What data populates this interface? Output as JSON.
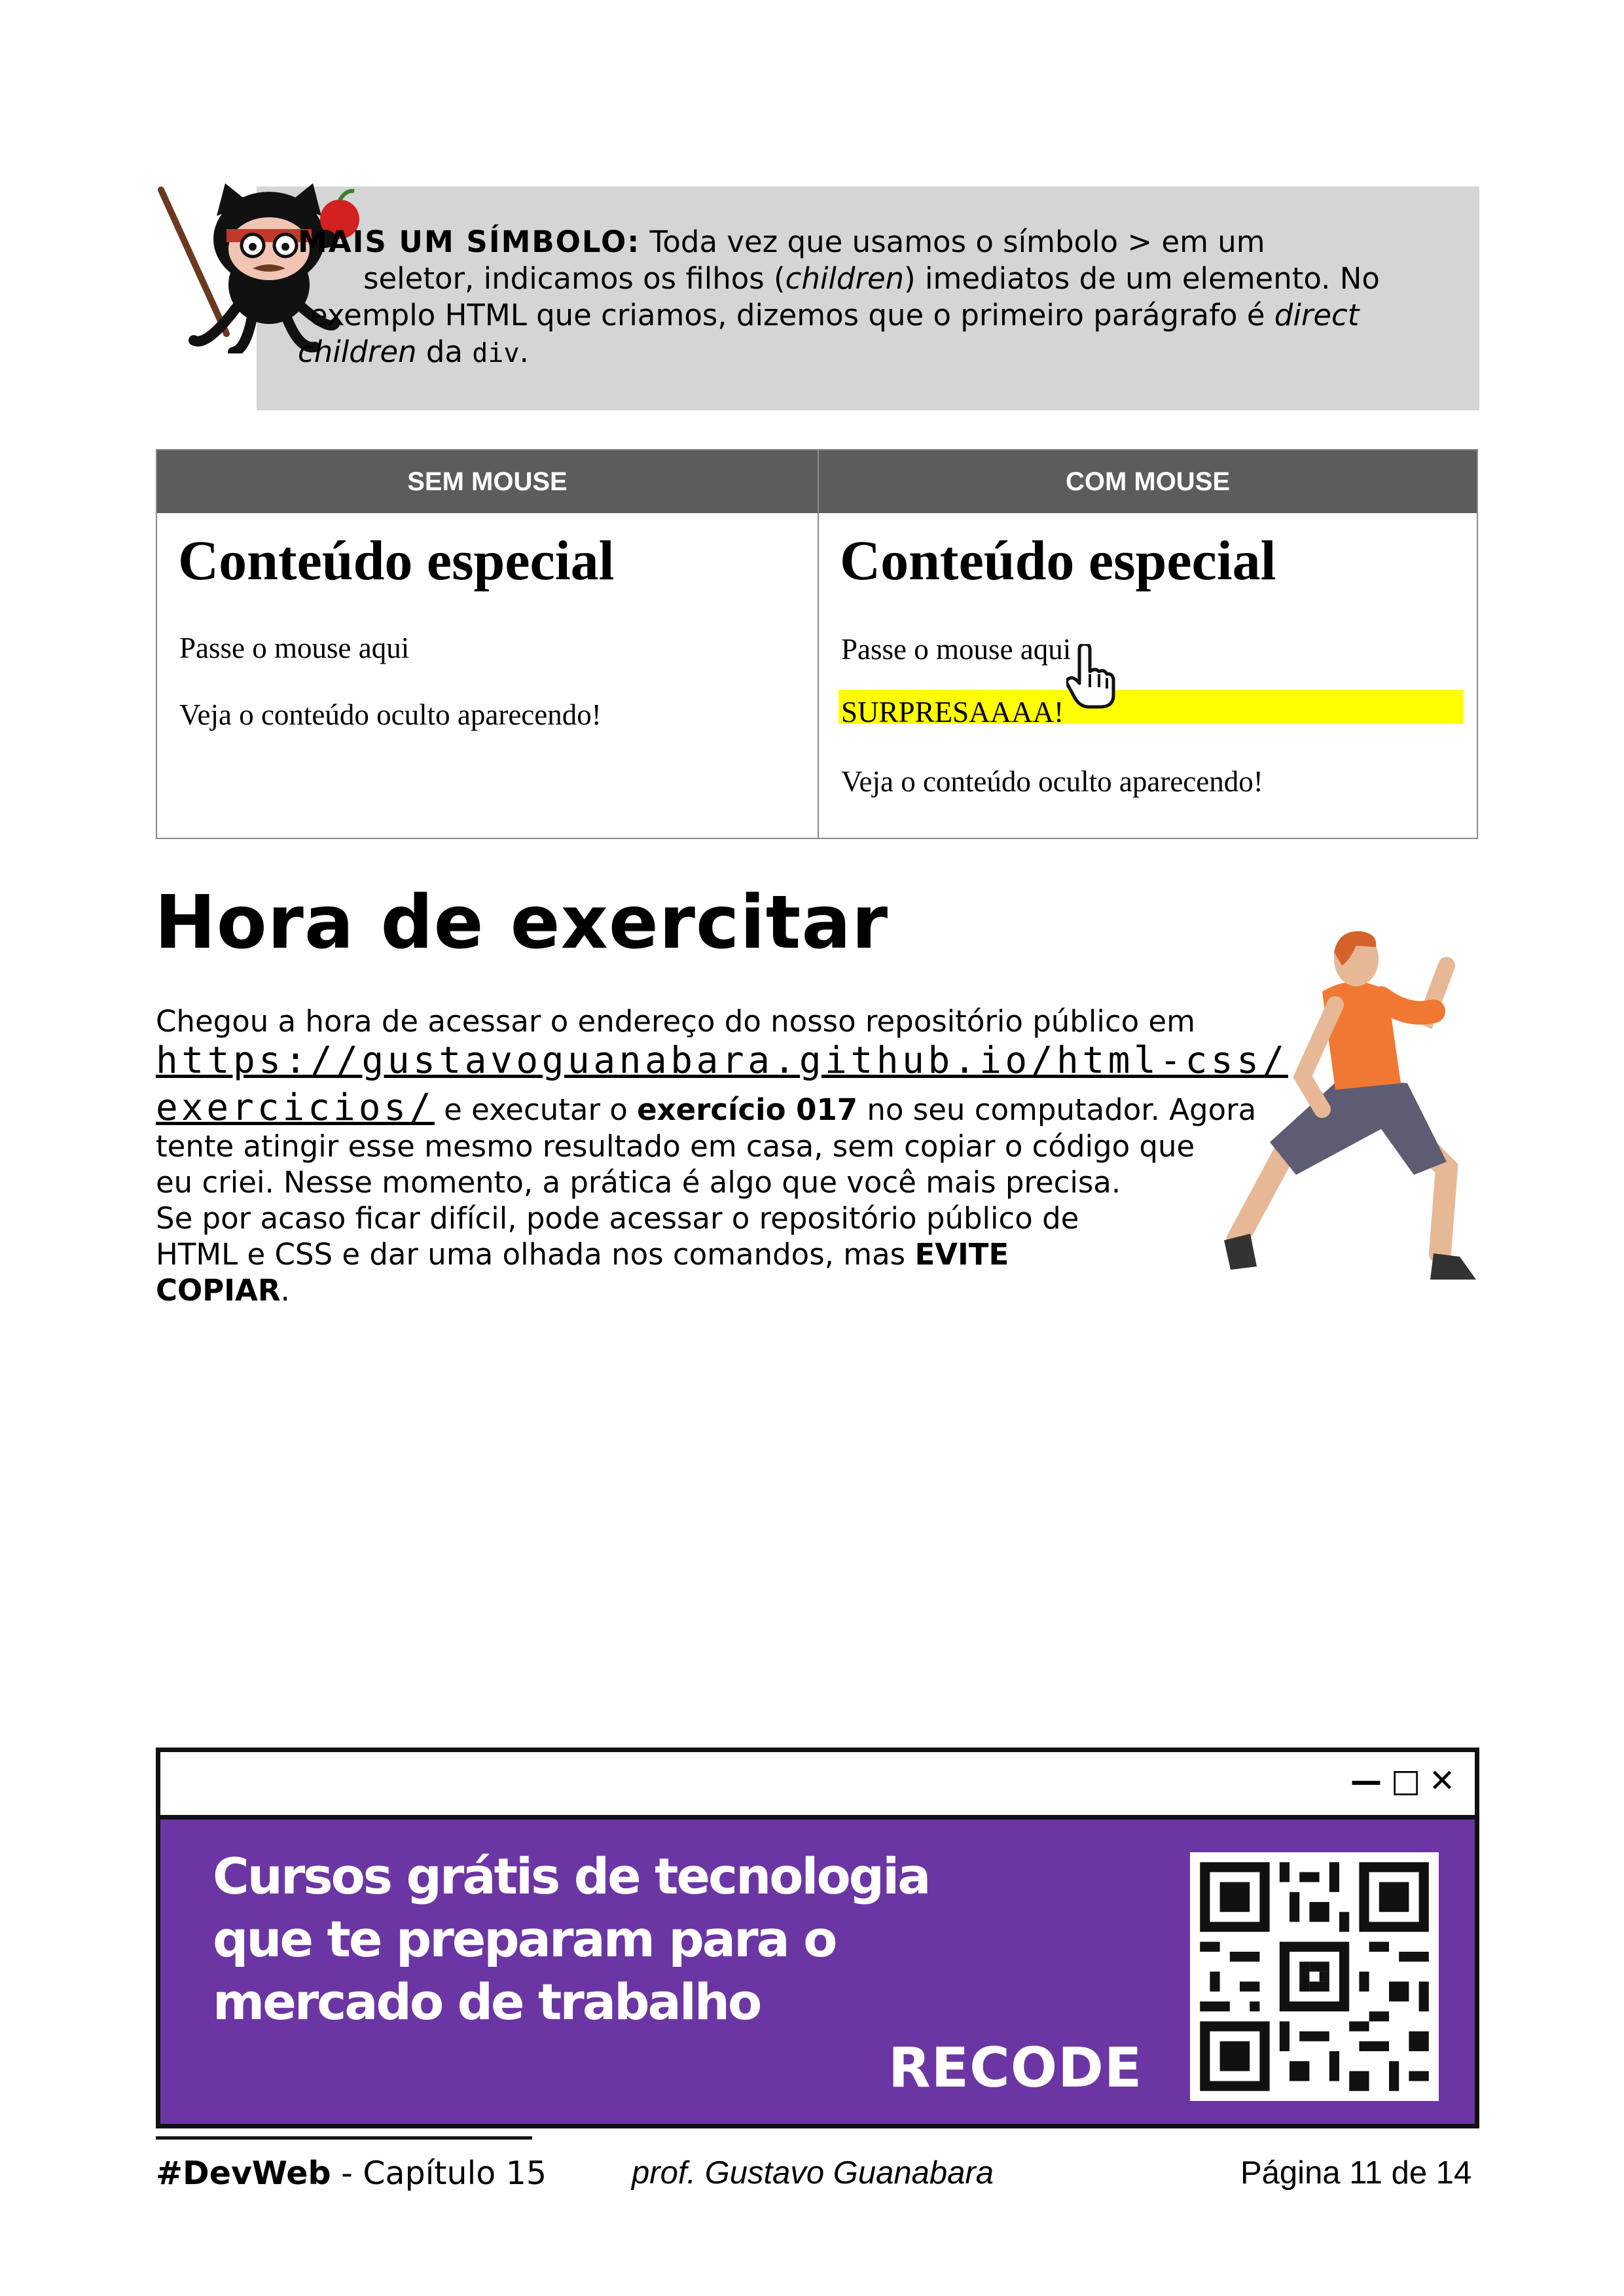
{
  "tip": {
    "label": "MAIS UM SÍMBOLO:",
    "text1": " Toda vez que usamos o símbolo > em um",
    "line2a": "seletor, indicamos os filhos (",
    "line2i": "children",
    "line2b": ") imediatos de um elemento. No",
    "line3a": "exemplo HTML que criamos, dizemos que o primeiro parágrafo é ",
    "line3i": "direct",
    "line4i": "children",
    "line4a": " da ",
    "line4code": "div",
    "line4b": "."
  },
  "demo_table": {
    "headers": [
      "SEM MOUSE",
      "COM MOUSE"
    ],
    "left": {
      "title": "Conteúdo especial",
      "hover_text": "Passe o mouse aqui",
      "hidden_text": "Veja o conteúdo oculto aparecendo!"
    },
    "right": {
      "title": "Conteúdo especial",
      "hover_text": "Passe o mouse aqui",
      "surprise_text": "SURPRESAAAA!",
      "hidden_text": "Veja o conteúdo oculto aparecendo!"
    },
    "highlight_color": "#ffff00"
  },
  "exercise": {
    "heading": "Hora de exercitar",
    "line1": "Chegou a hora de acessar o endereço do nosso repositório público em",
    "url_part1": "https://gustavoguanabara.github.io/html-css/",
    "url_part2": "exercicios/",
    "line3a": " e executar o ",
    "line3b": "exercício 017",
    "line3c": " no seu computador. Agora",
    "line4": "tente atingir esse mesmo resultado em casa, sem copiar o código que",
    "line5": "eu criei. Nesse momento, a prática é algo que você mais precisa.",
    "line6": "Se por acaso ficar difícil, pode acessar o repositório público de",
    "line7a": "HTML e CSS e dar uma olhada nos comandos, mas ",
    "line7b": "EVITE",
    "line8": "COPIAR",
    "line8end": "."
  },
  "ad": {
    "line1": "Cursos grátis de tecnologia",
    "line2": "que te preparam para o",
    "line3": "mercado de trabalho",
    "brand": "RECODE",
    "window_controls": [
      "—",
      "□",
      "✕"
    ],
    "bg_color": "#6b36a3"
  },
  "footer": {
    "tag": "#DevWeb",
    "chapter": " - Capítulo 15",
    "author": "prof. Gustavo Guanabara",
    "page": "Página 11 de 14"
  }
}
